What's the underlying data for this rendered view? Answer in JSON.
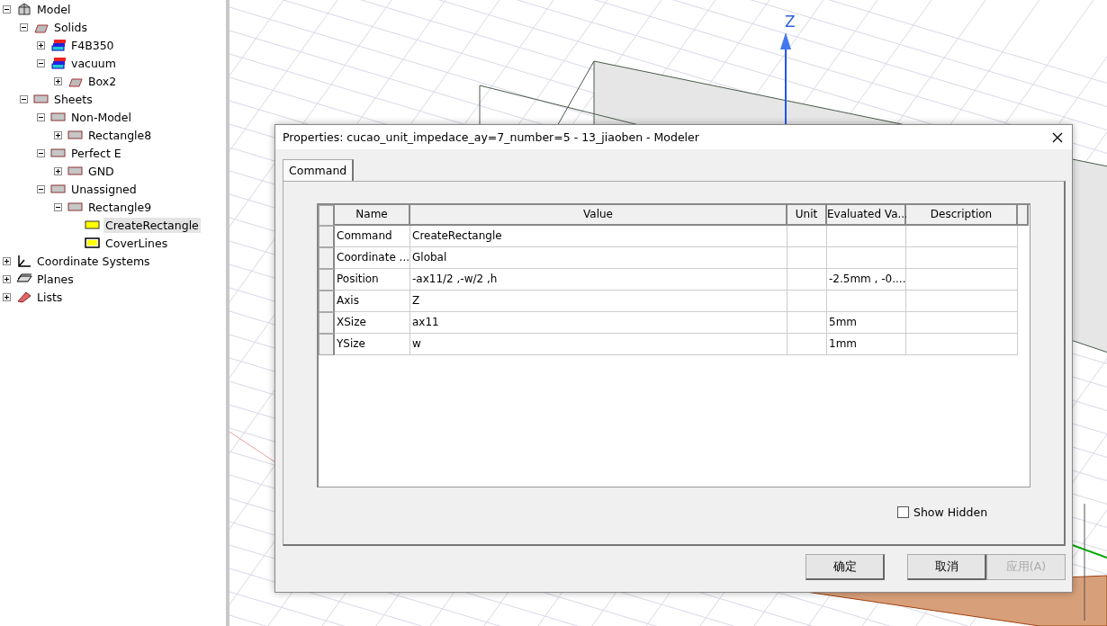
{
  "tree": [
    {
      "label": "Model",
      "kind": "model",
      "expanded": true,
      "selected": false,
      "children": [
        {
          "label": "Solids",
          "kind": "solid",
          "expanded": true,
          "selected": false,
          "children": [
            {
              "label": "F4B350",
              "kind": "material",
              "expanded": false,
              "selected": false
            },
            {
              "label": "vacuum",
              "kind": "material",
              "expanded": true,
              "selected": false,
              "children": [
                {
                  "label": "Box2",
                  "kind": "solid",
                  "expanded": false,
                  "selected": false
                }
              ]
            }
          ]
        },
        {
          "label": "Sheets",
          "kind": "sheet",
          "expanded": true,
          "selected": false,
          "children": [
            {
              "label": "Non-Model",
              "kind": "sheet",
              "expanded": true,
              "selected": false,
              "children": [
                {
                  "label": "Rectangle8",
                  "kind": "sheet",
                  "expanded": false,
                  "selected": false
                }
              ]
            },
            {
              "label": "Perfect E",
              "kind": "sheet",
              "expanded": true,
              "selected": false,
              "children": [
                {
                  "label": "GND",
                  "kind": "sheet",
                  "expanded": false,
                  "selected": false
                }
              ]
            },
            {
              "label": "Unassigned",
              "kind": "sheet",
              "expanded": true,
              "selected": false,
              "children": [
                {
                  "label": "Rectangle9",
                  "kind": "sheet",
                  "expanded": true,
                  "selected": false,
                  "children": [
                    {
                      "label": "CreateRectangle",
                      "kind": "command",
                      "selected": true
                    },
                    {
                      "label": "CoverLines",
                      "kind": "cover",
                      "selected": false
                    }
                  ]
                }
              ]
            }
          ]
        }
      ]
    },
    {
      "label": "Coordinate Systems",
      "kind": "coords",
      "expanded": false,
      "selected": false
    },
    {
      "label": "Planes",
      "kind": "planes",
      "expanded": false,
      "selected": false
    },
    {
      "label": "Lists",
      "kind": "lists",
      "expanded": false,
      "selected": false
    }
  ],
  "viewport": {
    "axis_label": "Z"
  },
  "dialog": {
    "title": "Properties: cucao_unit_impedace_ay=7_number=5 - 13_jiaoben - Modeler",
    "tabs": [
      {
        "label": "Command",
        "selected": true
      }
    ],
    "table": {
      "columns": [
        "Name",
        "Value",
        "Unit",
        "Evaluated Va...",
        "Description"
      ],
      "rows": [
        [
          "Command",
          "CreateRectangle",
          "",
          "",
          ""
        ],
        [
          "Coordinate ...",
          "Global",
          "",
          "",
          ""
        ],
        [
          "Position",
          "-ax11/2 ,-w/2 ,h",
          "",
          "-2.5mm , -0....",
          ""
        ],
        [
          "Axis",
          "Z",
          "",
          "",
          ""
        ],
        [
          "XSize",
          "ax11",
          "",
          "5mm",
          ""
        ],
        [
          "YSize",
          "w",
          "",
          "1mm",
          ""
        ]
      ]
    },
    "show_hidden": {
      "label": "Show Hidden",
      "checked": false
    },
    "buttons": [
      {
        "label": "确定",
        "disabled": false
      },
      {
        "label": "取消",
        "disabled": false
      },
      {
        "label": "应用(A)",
        "disabled": true
      }
    ]
  }
}
